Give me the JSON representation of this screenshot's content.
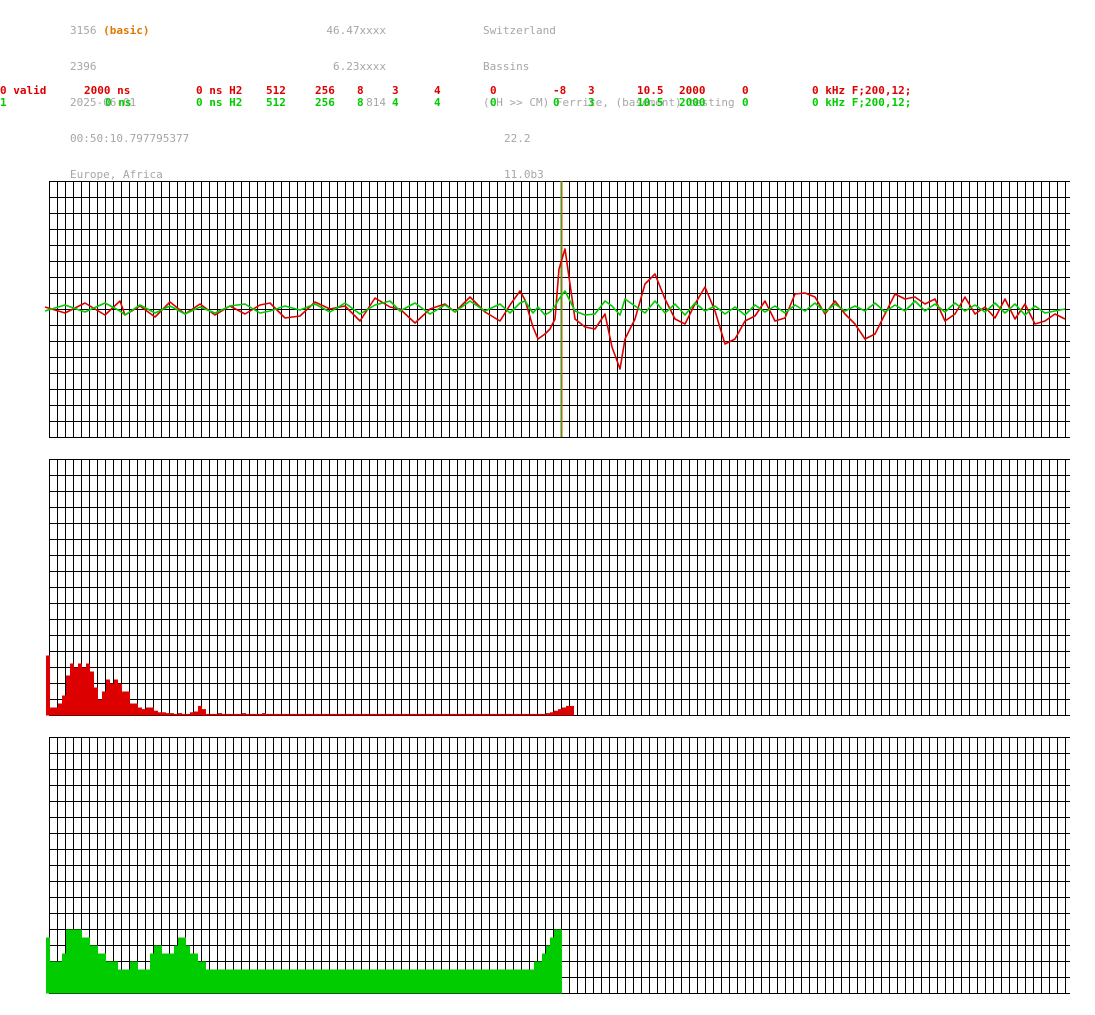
{
  "header": {
    "col1": [
      "3156",
      "2396",
      "2025-06-01",
      "00:50:10.797795377",
      "Europe, Africa"
    ],
    "basic_tag": "(basic)",
    "col2": [
      "46.47xxxx",
      "6.23xxxx",
      "814"
    ],
    "col3": [
      "Switzerland",
      "Bassins",
      "(CH >> CM) Ferrite, (basement) testing",
      "22.2",
      "11.0b3"
    ]
  },
  "params": {
    "row1": [
      "0 valid",
      "2000 ns",
      "0 ns H2",
      "512",
      "256",
      "8",
      "3",
      "4",
      "0",
      "-8",
      "3",
      "10.5",
      "2000",
      "0",
      "0 kHz F;200,12;"
    ],
    "row2": [
      "1",
      "0 ns",
      "0 ns H2",
      "512",
      "256",
      "8",
      "4",
      "4",
      "0",
      "0",
      "3",
      "10.5",
      "2000",
      "0",
      "0 kHz F;200,12;"
    ]
  },
  "colors": {
    "red": "#dd0000",
    "green": "#00cc00",
    "grid": "#000000",
    "meta": "#a6a6a6",
    "basic": "#e07800"
  },
  "chart_data": [
    {
      "type": "line",
      "title": "",
      "xlabel": "",
      "ylabel": "",
      "xlim": [
        0,
        1020
      ],
      "ylim": [
        -128,
        128
      ],
      "grid": true,
      "marker_x": 511,
      "series": [
        {
          "color": "#dd0000",
          "x": [
            0,
            20,
            40,
            60,
            75,
            80,
            95,
            110,
            125,
            140,
            155,
            170,
            185,
            200,
            215,
            225,
            240,
            255,
            270,
            285,
            300,
            315,
            330,
            345,
            355,
            370,
            385,
            400,
            410,
            425,
            440,
            455,
            465,
            475,
            480,
            488,
            493,
            500,
            505,
            510,
            514,
            520,
            530,
            540,
            550,
            560,
            567,
            575,
            580,
            590,
            600,
            610,
            620,
            630,
            640,
            650,
            660,
            670,
            680,
            690,
            700,
            710,
            720,
            730,
            740,
            750,
            760,
            770,
            780,
            790,
            800,
            810,
            820,
            830,
            840,
            850,
            860,
            870,
            880,
            890,
            900,
            910,
            920,
            930,
            940,
            950,
            960,
            970,
            980,
            990,
            1000,
            1010,
            1020
          ],
          "y": [
            2,
            -4,
            6,
            -6,
            8,
            -6,
            3,
            -8,
            7,
            -5,
            5,
            -6,
            3,
            -5,
            4,
            6,
            -9,
            -7,
            7,
            0,
            3,
            -12,
            11,
            2,
            0,
            -14,
            0,
            5,
            -3,
            12,
            -3,
            -12,
            4,
            18,
            9,
            -18,
            -30,
            -25,
            -20,
            -10,
            40,
            60,
            -10,
            -18,
            -20,
            -5,
            -38,
            -60,
            -30,
            -10,
            25,
            35,
            10,
            -10,
            -15,
            5,
            22,
            -2,
            -35,
            -30,
            -12,
            -7,
            8,
            -12,
            -9,
            15,
            16,
            12,
            -5,
            8,
            -5,
            -15,
            -30,
            -25,
            -5,
            15,
            10,
            12,
            5,
            10,
            -12,
            -5,
            12,
            -5,
            2,
            -9,
            10,
            -10,
            5,
            -15,
            -12,
            -5,
            -10
          ]
        },
        {
          "color": "#00cc00",
          "x": [
            0,
            20,
            40,
            60,
            75,
            80,
            95,
            110,
            125,
            140,
            155,
            170,
            185,
            200,
            215,
            225,
            240,
            255,
            270,
            285,
            300,
            315,
            330,
            345,
            355,
            370,
            385,
            400,
            410,
            425,
            440,
            455,
            465,
            475,
            480,
            488,
            493,
            500,
            505,
            510,
            514,
            520,
            530,
            540,
            550,
            560,
            567,
            575,
            580,
            590,
            600,
            610,
            620,
            630,
            640,
            650,
            660,
            670,
            680,
            690,
            700,
            710,
            720,
            730,
            740,
            750,
            760,
            770,
            780,
            790,
            800,
            810,
            820,
            830,
            840,
            850,
            860,
            870,
            880,
            890,
            900,
            910,
            920,
            930,
            940,
            950,
            960,
            970,
            980,
            990,
            1000,
            1010,
            1020
          ],
          "y": [
            -2,
            4,
            -3,
            6,
            -2,
            -6,
            4,
            -4,
            3,
            -5,
            2,
            -4,
            3,
            5,
            -4,
            -2,
            3,
            -1,
            5,
            -3,
            6,
            -5,
            4,
            8,
            -2,
            6,
            -5,
            4,
            -3,
            8,
            -2,
            5,
            -4,
            6,
            8,
            -4,
            2,
            -6,
            -3,
            3,
            10,
            18,
            -2,
            -6,
            -5,
            8,
            3,
            -6,
            10,
            3,
            -4,
            8,
            -4,
            5,
            -6,
            6,
            -2,
            3,
            -5,
            2,
            -6,
            4,
            -3,
            3,
            -4,
            4,
            -2,
            6,
            -3,
            5,
            -2,
            3,
            -2,
            6,
            -3,
            4,
            -2,
            8,
            -2,
            5,
            -3,
            6,
            -2,
            4,
            -3,
            6,
            -4,
            5,
            -6,
            3,
            -4,
            -2,
            0
          ]
        }
      ]
    },
    {
      "type": "bar",
      "title": "",
      "ylim": [
        0,
        128
      ],
      "color": "#dd0000",
      "values": [
        7.5,
        1,
        1,
        1.5,
        2.5,
        5,
        6.5,
        6,
        6.5,
        6,
        6.5,
        5.5,
        3.5,
        2,
        3,
        4.5,
        4,
        4.5,
        4,
        3,
        3,
        1.5,
        1.5,
        1,
        0.8,
        1,
        1,
        0.6,
        0.4,
        0.4,
        0.3,
        0.3,
        0.2,
        0.3,
        0.2,
        0.2,
        0.4,
        0.5,
        1.2,
        0.8,
        0.2,
        0.2,
        0.2,
        0.3,
        0.2,
        0.2,
        0.2,
        0.2,
        0.2,
        0.3,
        0.2,
        0.2,
        0.2,
        0.2,
        0.3,
        0.2,
        0.2,
        0.2,
        0.2,
        0.2,
        0.2,
        0.2,
        0.2,
        0.2,
        0.2,
        0.2,
        0.2,
        0.2,
        0.2,
        0.2,
        0.2,
        0.2,
        0.2,
        0.2,
        0.2,
        0.2,
        0.2,
        0.2,
        0.2,
        0.2,
        0.2,
        0.2,
        0.2,
        0.2,
        0.2,
        0.2,
        0.2,
        0.2,
        0.2,
        0.2,
        0.2,
        0.2,
        0.2,
        0.2,
        0.2,
        0.2,
        0.2,
        0.2,
        0.2,
        0.2,
        0.2,
        0.2,
        0.2,
        0.2,
        0.2,
        0.2,
        0.2,
        0.2,
        0.2,
        0.2,
        0.2,
        0.2,
        0.2,
        0.2,
        0.2,
        0.2,
        0.2,
        0.2,
        0.2,
        0.2,
        0.2,
        0.2,
        0.2,
        0.2,
        0.2,
        0.3,
        0.4,
        0.6,
        0.8,
        1,
        1.2,
        1.2
      ],
      "value_scale": 8
    },
    {
      "type": "bar",
      "title": "",
      "ylim": [
        0,
        128
      ],
      "color": "#00cc00",
      "values": [
        7,
        4,
        4,
        4,
        5,
        8,
        8,
        8,
        8,
        7,
        7,
        6,
        6,
        5,
        5,
        4,
        4,
        4,
        3,
        3,
        3,
        4,
        4,
        3,
        3,
        3,
        5,
        6,
        6,
        5,
        5,
        5,
        6,
        7,
        7,
        6,
        5,
        5,
        4,
        4,
        3,
        3,
        3,
        3,
        3,
        3,
        3,
        3,
        3,
        3,
        3,
        3,
        3,
        3,
        3,
        3,
        3,
        3,
        3,
        3,
        3,
        3,
        3,
        3,
        3,
        3,
        3,
        3,
        3,
        3,
        3,
        3,
        3,
        3,
        3,
        3,
        3,
        3,
        3,
        3,
        3,
        3,
        3,
        3,
        3,
        3,
        3,
        3,
        3,
        3,
        3,
        3,
        3,
        3,
        3,
        3,
        3,
        3,
        3,
        3,
        3,
        3,
        3,
        3,
        3,
        3,
        3,
        3,
        3,
        3,
        3,
        3,
        3,
        3,
        3,
        3,
        3,
        3,
        3,
        3,
        3,
        3,
        4,
        4,
        5,
        6,
        7,
        8,
        8
      ],
      "value_scale": 8
    }
  ]
}
